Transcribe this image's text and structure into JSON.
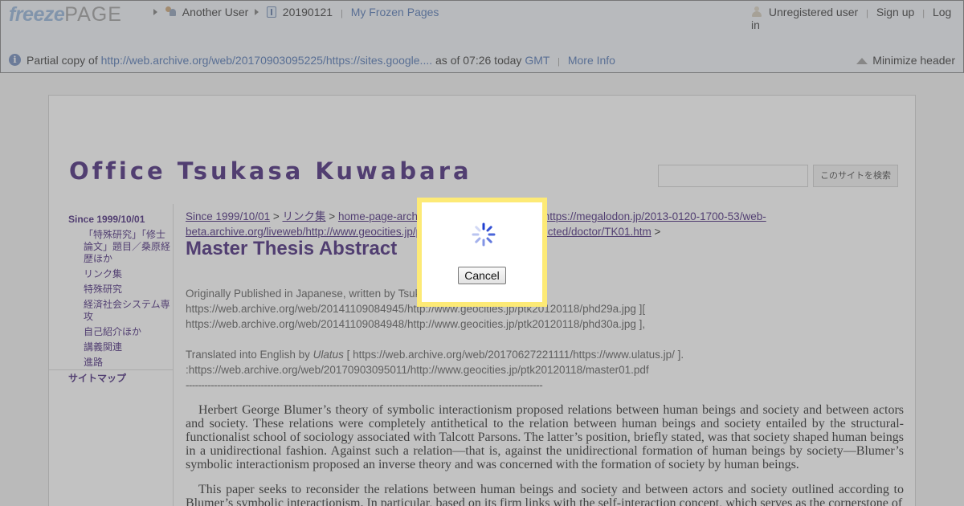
{
  "freezepage": {
    "logo_freeze": "freeze",
    "logo_page": "PAGE",
    "owner": "Another User",
    "page_id": "20190121",
    "my_frozen_pages": "My Frozen Pages",
    "user_status": "Unregistered user",
    "sign_up": "Sign up",
    "log_in": "Log in",
    "partial_prefix": "Partial copy of",
    "source_url": "http://web.archive.org/web/20170903095225/https://sites.google....",
    "as_of": "as of 07:26 today",
    "gmt": "GMT",
    "more_info": "More Info",
    "minimize_header": "Minimize header"
  },
  "site": {
    "title": "Office Tsukasa Kuwabara",
    "search_button": "このサイトを検索",
    "search_placeholder": ""
  },
  "sidebar": {
    "items": [
      {
        "label": "Since 1999/10/01"
      },
      {
        "label": "「特殊研究」「修士論文」題目／桑原経歴ほか"
      },
      {
        "label": "リンク集"
      },
      {
        "label": "特殊研究"
      },
      {
        "label": "経済社会システム専攻"
      },
      {
        "label": "自己紹介ほか"
      },
      {
        "label": "講義関連"
      },
      {
        "label": "進路"
      },
      {
        "label": "サイトマップ"
      }
    ]
  },
  "content": {
    "breadcrumb_1": "Since 1999/10/01",
    "breadcrumb_sep": ">",
    "breadcrumb_2": "リンク集",
    "breadcrumb_3": "home-page-archi",
    "breadcrumb_4_tail": "https://megalodon.jp/2013-0120-1700-53/web-",
    "breadcrumb_line2_a": "beta.archive.org/liveweb/http://www.geocities.jp/p",
    "breadcrumb_line2_b": "01Reflected/doctor/TK01.htm",
    "title": "Master Thesis Abstract",
    "orig_published": "Originally Published in Japanese, written by Tsuk",
    "orig_url_1": "https://web.archive.org/web/20141109084945/http://www.geocities.jp/ptk20120118/phd29a.jpg ][",
    "orig_url_2": "https://web.archive.org/web/20141109084948/http://www.geocities.jp/ptk20120118/phd30a.jpg ],",
    "translated_prefix": "Translated into English by",
    "translator": "Ulatus",
    "translator_url": " [ https://web.archive.org/web/20170627221111/https://www.ulatus.jp/ ].",
    "source_pdf": " :https://web.archive.org/web/20170903095011/http://www.geocities.jp/ptk20120118/master01.pdf",
    "dashes": "------------------------------------------------------------------------------------------------------------------",
    "paragraph_1": "Herbert George Blumer’s theory of symbolic interactionism proposed relations between human beings and society and between actors and society. These relations were completely antithetical to the relation between human beings and society entailed by the structural-functionalist school of sociology associated with Talcott Parsons. The latter’s position, briefly stated, was that society shaped human beings in a unidirectional fashion. Against such a relation—that is, against the unidirectional formation of human beings by society—Blumer’s symbolic interactionism proposed an inverse theory and was concerned with the formation of society by human beings.",
    "paragraph_2": "This paper seeks to reconsider the relations between human beings and society and between actors and society outlined according to Blumer’s symbolic interactionism. In particular, based on its firm links with the self-interaction concept, which serves as the cornerstone of"
  },
  "dialog": {
    "cancel": "Cancel"
  },
  "colors": {
    "site_accent": "#3d1c74",
    "dialog_border": "#fdea76",
    "link_blue": "#4b70b0"
  }
}
